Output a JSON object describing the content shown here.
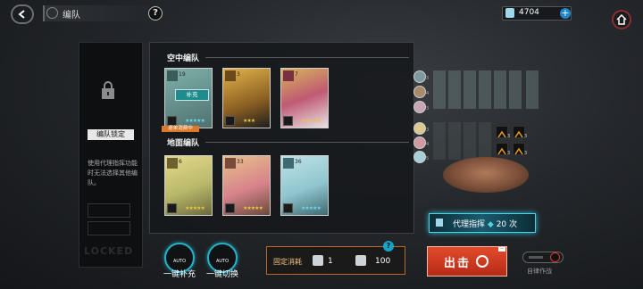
{
  "header": {
    "title": "编队",
    "help": "?",
    "currency_value": "4704",
    "plus": "+"
  },
  "locked_panel": {
    "title": "编队锁定",
    "description": "使用代理指挥功能时无法选择其他编队。",
    "watermark": "LOCKED"
  },
  "formation": {
    "air_label": "空中编队",
    "ground_label": "地面编队",
    "air_cards": [
      {
        "num": "19",
        "stars": "★★★★★",
        "star_color": "#6fd4e8",
        "bg": "#5f8a86",
        "supply_badge": "补充",
        "assist_tag": "逐单消费中"
      },
      {
        "num": "3",
        "stars": "★★★",
        "star_color": "#e8c44a",
        "bg": "#c89a3a"
      },
      {
        "num": "7",
        "stars": "★★★★★",
        "star_color": "#e8c44a",
        "bg": "#b54a6a"
      }
    ],
    "ground_cards": [
      {
        "num": "6",
        "stars": "★★★★★",
        "star_color": "#e8c44a",
        "bg": "#c9c070"
      },
      {
        "num": "33",
        "stars": "★★★★★",
        "star_color": "#e8c44a",
        "bg": "#c69a72"
      },
      {
        "num": "36",
        "stars": "★★★★★",
        "star_color": "#6fd4e8",
        "bg": "#7aa7ad"
      }
    ]
  },
  "right_grid": {
    "avatar_levels": [
      "3",
      "4",
      "3",
      "3",
      "4",
      "5"
    ],
    "skill_counts": [
      "3",
      "3",
      "3",
      "3"
    ]
  },
  "proxy": {
    "label": "代理指挥",
    "count": "20",
    "unit": "次"
  },
  "bottom": {
    "auto_fill_top": "AUTO",
    "auto_fill_label": "一键补充",
    "auto_switch_top": "AUTO",
    "auto_switch_label": "一键切换",
    "cost_label": "固定消耗",
    "cost_1": "1",
    "cost_2": "100",
    "cost_help": "?",
    "sortie_label": "出击",
    "auto_battle_label": "自律作战"
  },
  "colors": {
    "accent_cyan": "#27b1c9",
    "sortie_red": "#d43a22",
    "cost_border": "#b66a22"
  }
}
